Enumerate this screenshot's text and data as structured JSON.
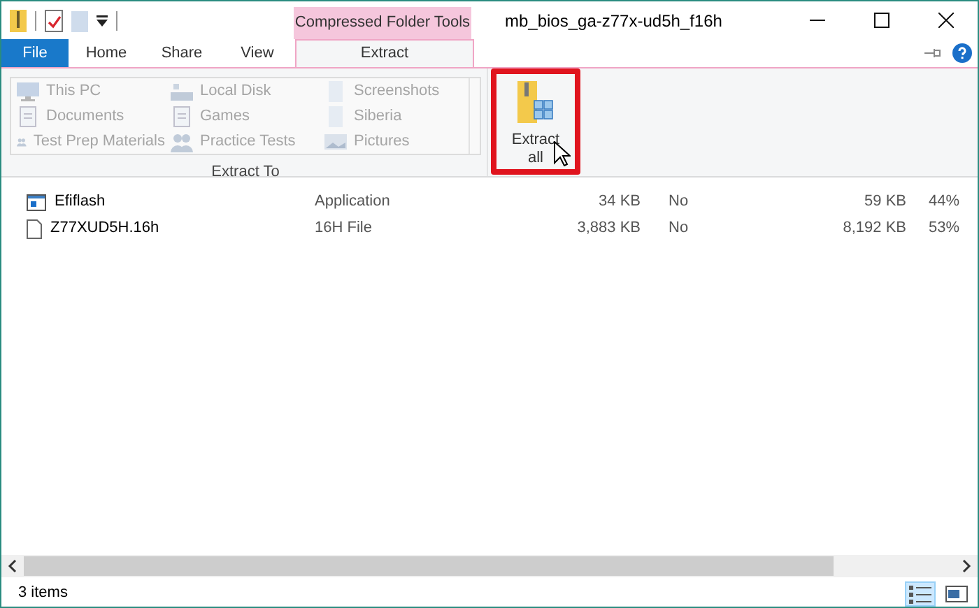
{
  "window": {
    "title": "mb_bios_ga-z77x-ud5h_f16h",
    "context_group": "Compressed Folder Tools"
  },
  "tabs": [
    {
      "label": "File",
      "kind": "file",
      "selected": false
    },
    {
      "label": "Home",
      "kind": "normal",
      "selected": false
    },
    {
      "label": "Share",
      "kind": "normal",
      "selected": false
    },
    {
      "label": "View",
      "kind": "normal",
      "selected": false
    },
    {
      "label": "Extract",
      "kind": "context",
      "selected": true
    }
  ],
  "extract_to": {
    "group_label": "Extract To",
    "locations": [
      {
        "label": "This PC",
        "kind": "pc",
        "disabled": true
      },
      {
        "label": "Local Disk",
        "kind": "disk",
        "disabled": true
      },
      {
        "label": "Screenshots",
        "kind": "folder",
        "disabled": true
      },
      {
        "label": "Documents",
        "kind": "documents",
        "disabled": true
      },
      {
        "label": "Games",
        "kind": "documents",
        "disabled": true
      },
      {
        "label": "Siberia",
        "kind": "folder",
        "disabled": true
      },
      {
        "label": "Test Prep Materials",
        "kind": "people",
        "disabled": true
      },
      {
        "label": "Practice Tests",
        "kind": "people",
        "disabled": true
      },
      {
        "label": "Pictures",
        "kind": "pictures",
        "disabled": true
      }
    ]
  },
  "extract_all": {
    "label_lines": [
      "Extract",
      "all"
    ],
    "highlighted": true
  },
  "files": [
    {
      "name": "Efiflash",
      "kind": "app",
      "type": "Application",
      "compressed_size": "34 KB",
      "password": "No",
      "size": "59 KB",
      "ratio": "44%"
    },
    {
      "name": "Z77XUD5H.16h",
      "kind": "file",
      "type": "16H File",
      "compressed_size": "3,883 KB",
      "password": "No",
      "size": "8,192 KB",
      "ratio": "53%"
    }
  ],
  "status_bar": {
    "item_count": "3 items"
  },
  "view_buttons": [
    {
      "kind": "details",
      "selected": true
    },
    {
      "kind": "thumbnails",
      "selected": false
    }
  ]
}
